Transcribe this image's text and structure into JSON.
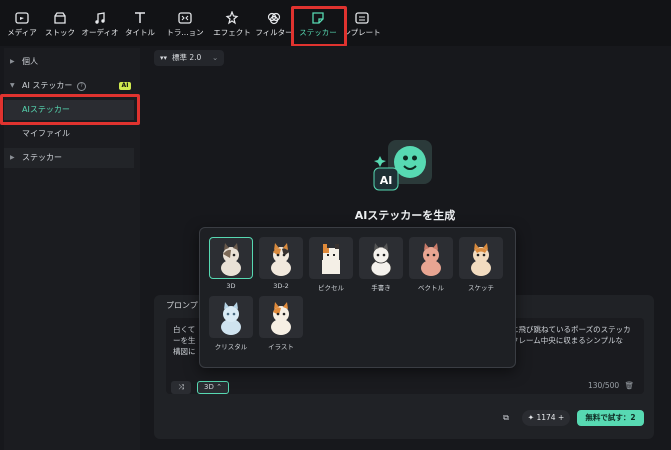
{
  "toolbar": {
    "items": [
      {
        "label": "メディア",
        "icon": "media-icon"
      },
      {
        "label": "ストック",
        "icon": "stock-icon"
      },
      {
        "label": "オーディオ",
        "icon": "music-note-icon"
      },
      {
        "label": "タイトル",
        "icon": "title-t-icon"
      },
      {
        "label": "トラ...ョン",
        "icon": "transition-icon"
      },
      {
        "label": "エフェクト",
        "icon": "effect-icon"
      },
      {
        "label": "フィルター",
        "icon": "filter-icon"
      },
      {
        "label": "ステッカー",
        "icon": "sticker-icon",
        "active": true
      },
      {
        "label": "ンプレート",
        "icon": "template-icon"
      }
    ]
  },
  "sidebar": {
    "personal": "個人",
    "ai_sticker_group": "AI ステッカー",
    "ai_badge": "AI",
    "ai_sticker_item": "AIステッカー",
    "my_files": "マイファイル",
    "sticker_group": "ステッカー"
  },
  "model_selector": {
    "value": "標準 2.0"
  },
  "hero": {
    "title": "AIステッカーを生成",
    "subtitle": "..."
  },
  "prompt": {
    "label": "プロンプ",
    "text_line1": "白くて",
    "text_right1": "に飛び跳ねているポーズのステッカ",
    "text_line2": "ーを生",
    "text_right2": "フレーム中央に収まるシンプルな",
    "text_line3": "構図に",
    "style_value": "3D",
    "counter": "130/500"
  },
  "credits": {
    "value": "1174"
  },
  "try_button": {
    "label": "無料で試す：2"
  },
  "styles": [
    {
      "label": "3D",
      "selected": true
    },
    {
      "label": "3D-2"
    },
    {
      "label": "ピクセル"
    },
    {
      "label": "手書き"
    },
    {
      "label": "ベクトル"
    },
    {
      "label": "スケッチ"
    },
    {
      "label": "クリスタル"
    },
    {
      "label": "イラスト"
    }
  ],
  "colors": {
    "accent": "#57d9b2",
    "highlight": "#e0332f",
    "badge": "#cfe94f"
  }
}
